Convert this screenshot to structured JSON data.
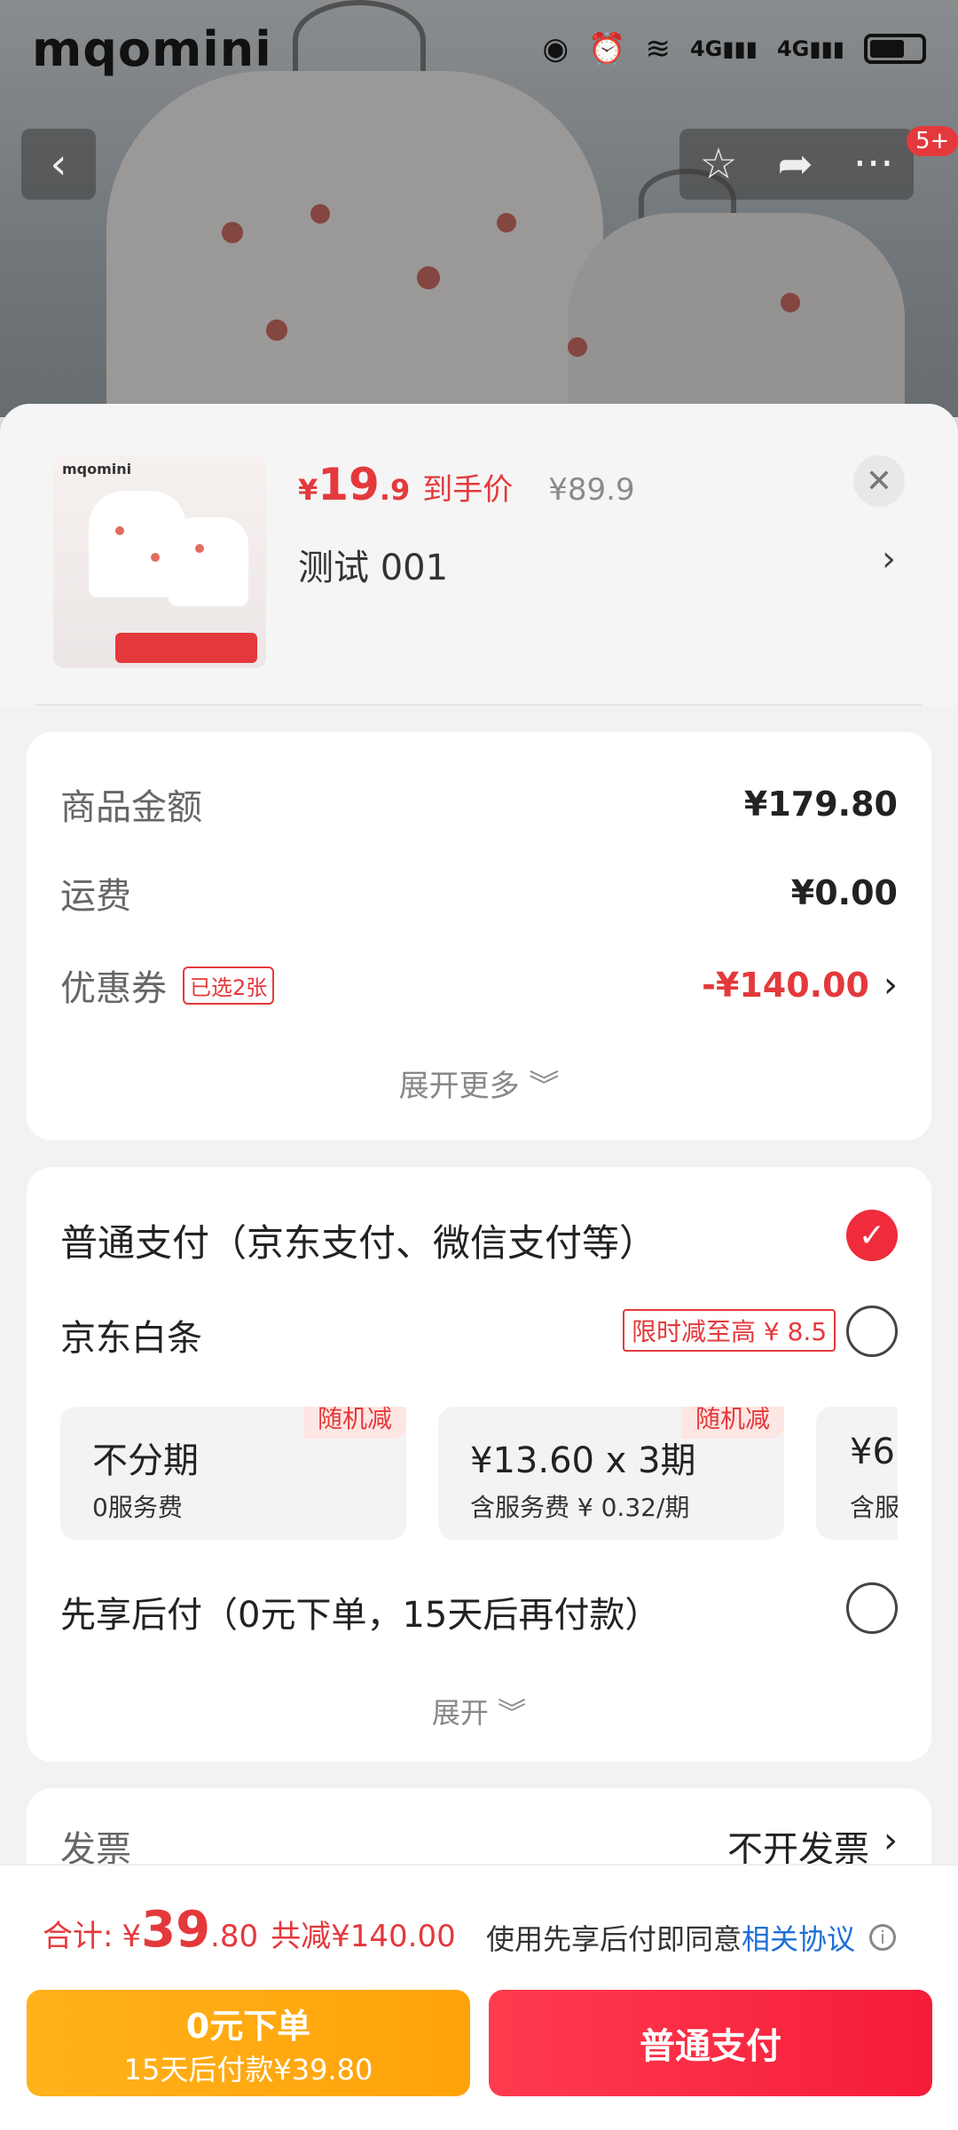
{
  "status_bar": {
    "brand": "mqomini",
    "network_1": "4G",
    "network_2": "4G"
  },
  "header": {
    "badge": "5+"
  },
  "product": {
    "thumb_brand": "mqomini",
    "currency": "¥",
    "price_int": "19",
    "price_dec": ".9",
    "price_tag": "到手价",
    "original_price": "¥89.9",
    "spec": "测试  001"
  },
  "amount": {
    "rows": [
      {
        "label": "商品金额",
        "value": "¥179.80"
      },
      {
        "label": "运费",
        "value": "¥0.00"
      },
      {
        "label": "优惠券",
        "tag": "已选2张",
        "value": "-¥140.00"
      }
    ],
    "expand_label": "展开更多"
  },
  "payment": {
    "normal_label": "普通支付（京东支付、微信支付等）",
    "baitiao_label": "京东白条",
    "baitiao_tag": "限时减至高 ¥ 8.5",
    "plans": [
      {
        "title": "不分期",
        "sub": "0服务费",
        "tag": "随机减"
      },
      {
        "title": "¥13.60 x 3期",
        "sub": "含服务费 ¥ 0.32/期",
        "tag": "随机减"
      },
      {
        "title": "¥6.",
        "sub": "含服"
      }
    ],
    "later_label": "先享后付（0元下单，15天后再付款）",
    "expand_label": "展开"
  },
  "invoice": {
    "label": "发票",
    "value": "不开发票"
  },
  "footer": {
    "total_label": "合计:",
    "total_yen": "¥",
    "total_int": "39",
    "total_dec": ".80",
    "saved": "共减¥140.00",
    "agree_text": "使用先享后付即同意",
    "agree_link": "相关协议",
    "btn_later_main": "0元下单",
    "btn_later_sub": "15天后付款¥39.80",
    "btn_normal": "普通支付"
  },
  "colors": {
    "accent": "#e4393c",
    "primary_button": "#f51c3a",
    "later_button": "#ffa20a",
    "link": "#1e6fd8"
  }
}
